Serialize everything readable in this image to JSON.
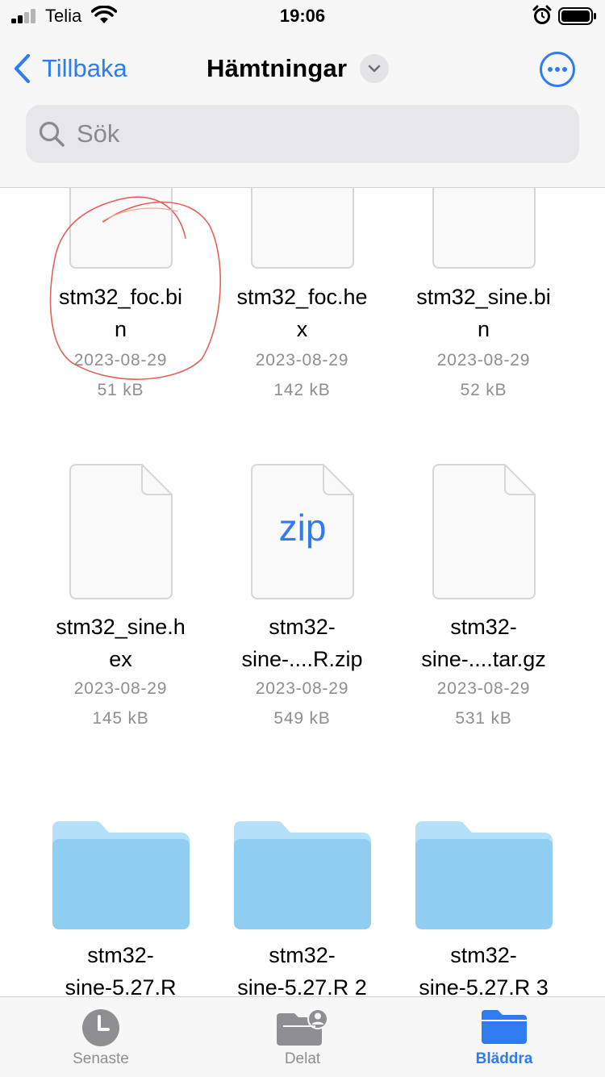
{
  "status_bar": {
    "carrier": "Telia",
    "time": "19:06"
  },
  "header": {
    "back_label": "Tillbaka",
    "title": "Hämtningar",
    "search_placeholder": "Sök"
  },
  "files": [
    {
      "name_line1": "stm32_foc.bi",
      "name_line2": "n",
      "date": "2023-08-29",
      "size": "51 kB",
      "icon": "document-icon"
    },
    {
      "name_line1": "stm32_foc.he",
      "name_line2": "x",
      "date": "2023-08-29",
      "size": "142 kB",
      "icon": "document-icon"
    },
    {
      "name_line1": "stm32_sine.bi",
      "name_line2": "n",
      "date": "2023-08-29",
      "size": "52 kB",
      "icon": "document-icon"
    },
    {
      "name_line1": "stm32_sine.h",
      "name_line2": "ex",
      "date": "2023-08-29",
      "size": "145 kB",
      "icon": "document-icon"
    },
    {
      "name_line1": "stm32-",
      "name_line2": "sine-....R.zip",
      "date": "2023-08-29",
      "size": "549 kB",
      "icon": "zip-icon",
      "icon_text": "zip"
    },
    {
      "name_line1": "stm32-",
      "name_line2": "sine-....tar.gz",
      "date": "2023-08-29",
      "size": "531 kB",
      "icon": "document-icon"
    },
    {
      "name_line1": "stm32-",
      "name_line2": "sine-5.27.R",
      "icon": "folder-icon"
    },
    {
      "name_line1": "stm32-",
      "name_line2": "sine-5.27.R 2",
      "icon": "folder-icon"
    },
    {
      "name_line1": "stm32-",
      "name_line2": "sine-5.27.R 3",
      "icon": "folder-icon"
    }
  ],
  "tab_bar": {
    "tabs": [
      {
        "label": "Senaste",
        "icon": "clock-icon",
        "active": false
      },
      {
        "label": "Delat",
        "icon": "shared-folder-icon",
        "active": false
      },
      {
        "label": "Bläddra",
        "icon": "folder-icon",
        "active": true
      }
    ]
  },
  "colors": {
    "accent": "#2f7bf0",
    "annotation": "#e0504a",
    "folder": "#8fcdf2"
  }
}
